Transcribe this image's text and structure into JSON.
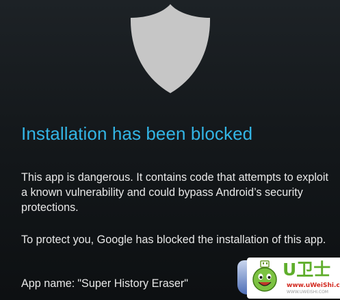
{
  "dialog": {
    "title": "Installation has been blocked",
    "message_1": "This app is dangerous. It contains code that attempts to exploit a known vulnerability and could bypass Android’s security protections.",
    "message_2": "To protect you, Google has blocked the installation of this app.",
    "app_name_label": "App name:",
    "app_name_value": "\"Super History Eraser\""
  },
  "icons": {
    "shield": "shield-icon"
  },
  "colors": {
    "title": "#33b5e5",
    "text": "#e8e8e8",
    "shield": "#c4c4c4",
    "background": "#161a1d"
  },
  "watermark": {
    "logo_text": "U卫士",
    "url": "www.uWeiShi.com",
    "url_small": "WWW.UWEISHI.COM"
  }
}
